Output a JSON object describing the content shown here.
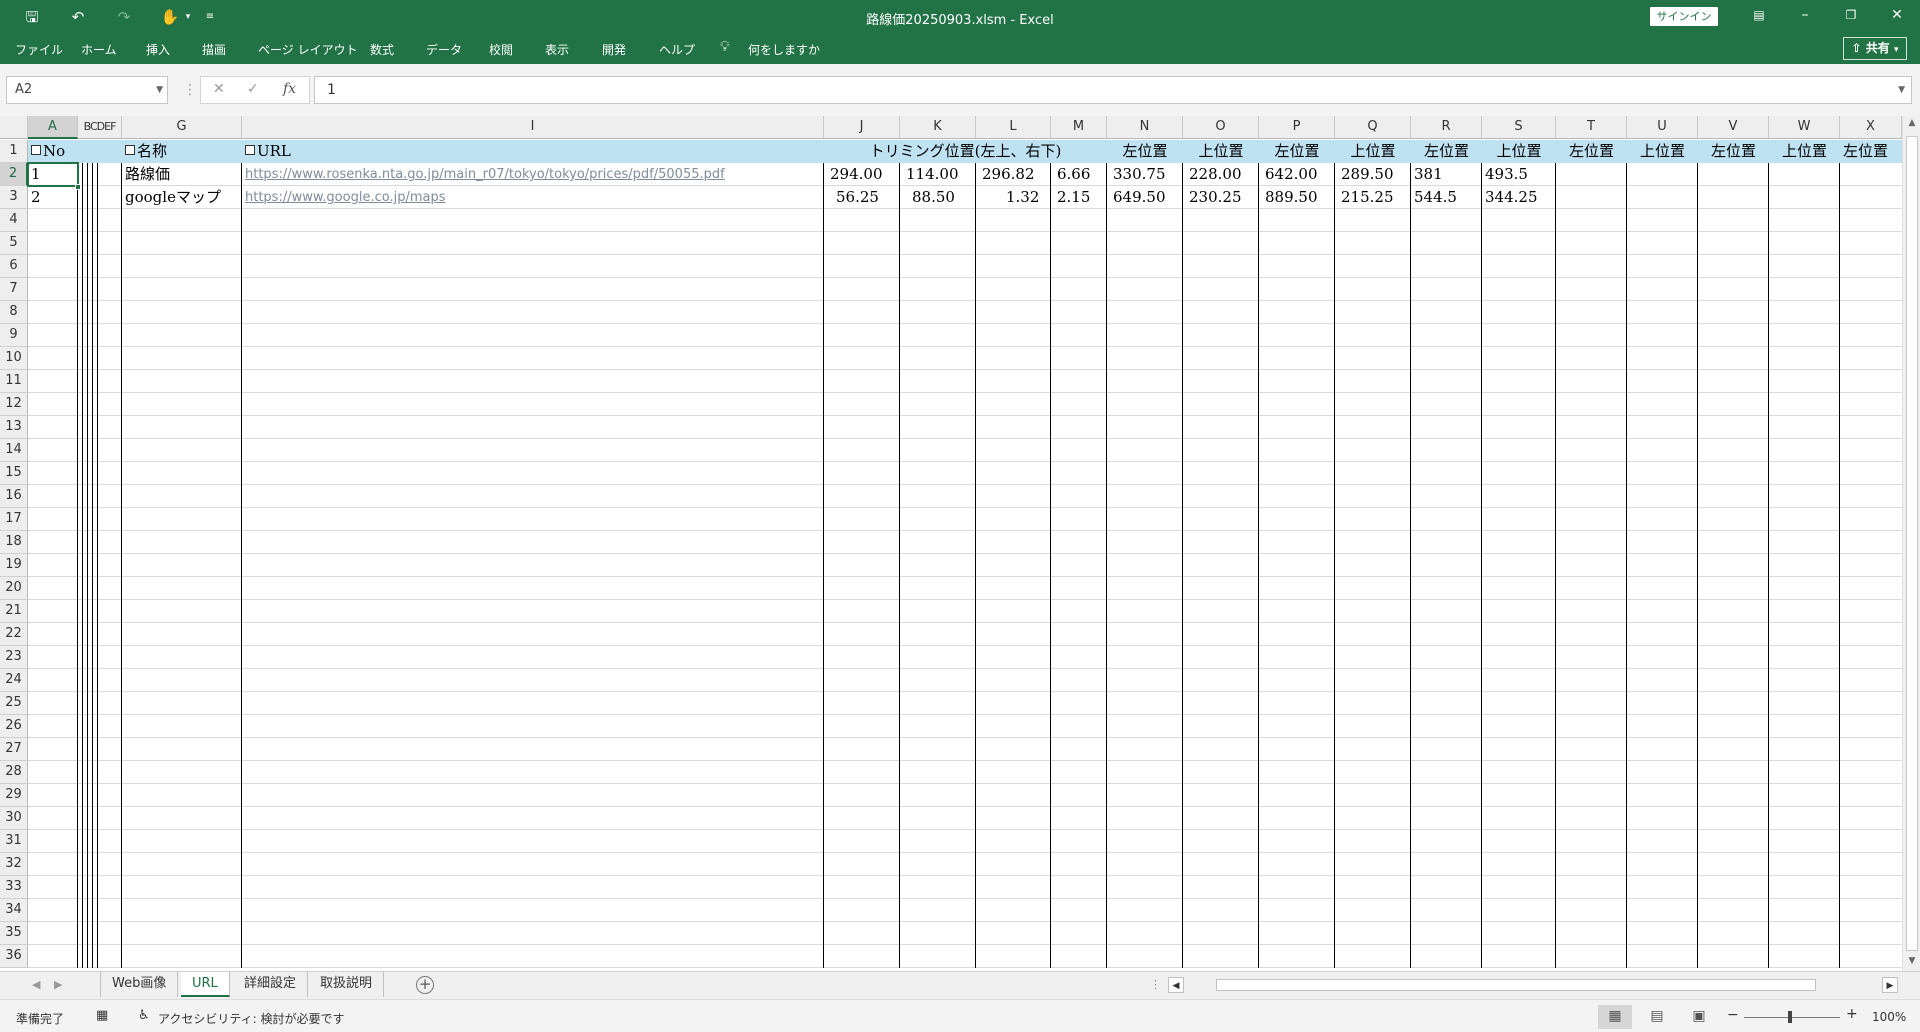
{
  "window": {
    "title": "路線価20250903.xlsm  -  Excel",
    "signin_label": "サインイン",
    "share_label": "共有"
  },
  "ribbon_tabs": [
    "ファイル",
    "ホーム",
    "挿入",
    "描画",
    "ページ レイアウト",
    "数式",
    "データ",
    "校閲",
    "表示",
    "開発",
    "ヘルプ"
  ],
  "tell_me": "何をしますか",
  "formula_bar": {
    "name_box": "A2",
    "formula": "1",
    "fx_label": "fx"
  },
  "columns": [
    "A",
    "BCDEF",
    "G",
    "I",
    "J",
    "K",
    "L",
    "M",
    "N",
    "O",
    "P",
    "Q",
    "R",
    "S",
    "T",
    "U",
    "V",
    "W",
    "X"
  ],
  "rows": [
    "1",
    "2",
    "3",
    "4",
    "5",
    "6",
    "7",
    "8",
    "9",
    "10",
    "11",
    "12",
    "13",
    "14",
    "15",
    "16",
    "17",
    "18",
    "19",
    "20",
    "21",
    "22",
    "23",
    "24",
    "25",
    "26",
    "27",
    "28",
    "29",
    "30",
    "31",
    "32",
    "33",
    "34",
    "35",
    "36"
  ],
  "header_row": {
    "a": "No",
    "g": "名称",
    "i": "URL",
    "jm": "トリミング位置(左上、右下)",
    "n": "左位置",
    "o": "上位置",
    "p": "左位置",
    "q": "上位置",
    "r": "左位置",
    "s": "上位置",
    "t": "左位置",
    "u": "上位置",
    "v": "左位置",
    "w": "上位置",
    "x": "左位置"
  },
  "data_rows": [
    {
      "no": "1",
      "name": "路線価",
      "url": "https://www.rosenka.nta.go.jp/main_r07/tokyo/tokyo/prices/pdf/50055.pdf",
      "j": "294.00",
      "k": "114.00",
      "l": "296.82",
      "m": "6.66",
      "n": "330.75",
      "o": "228.00",
      "p": "642.00",
      "q": "289.50",
      "r": "381",
      "s": "493.5"
    },
    {
      "no": "2",
      "name": "googleマップ",
      "url": "https://www.google.co.jp/maps",
      "j": "56.25",
      "k": "88.50",
      "l": "1.32",
      "m": "2.15",
      "n": "649.50",
      "o": "230.25",
      "p": "889.50",
      "q": "215.25",
      "r": "544.5",
      "s": "344.25"
    }
  ],
  "sheet_tabs": [
    "Web画像",
    "URL",
    "詳細設定",
    "取扱説明"
  ],
  "active_sheet": "URL",
  "status": {
    "ready": "準備完了",
    "accessibility": "アクセシビリティ: 検討が必要です",
    "zoom": "100%"
  },
  "colors": {
    "excel_green": "#217346",
    "header_fill": "#bfe2f3"
  }
}
